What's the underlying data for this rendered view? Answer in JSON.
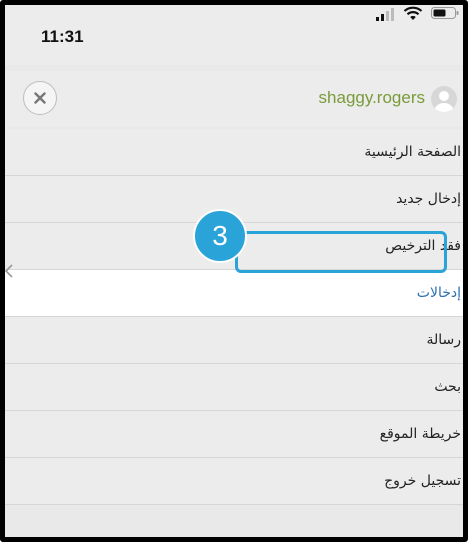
{
  "status_bar": {
    "time": "11:31"
  },
  "header": {
    "username": "shaggy.rogers",
    "close_icon": "close-icon",
    "avatar_icon": "avatar"
  },
  "menu": {
    "items": [
      {
        "label": "الصفحة الرئيسية",
        "active": false
      },
      {
        "label": "إدخال جديد",
        "active": false
      },
      {
        "label": "فقد الترخيص",
        "active": false
      },
      {
        "label": "إدخالات",
        "active": true
      },
      {
        "label": "رسالة",
        "active": false
      },
      {
        "label": "بحث",
        "active": false
      },
      {
        "label": "خريطة الموقع",
        "active": false
      },
      {
        "label": "تسجيل خروج",
        "active": false
      }
    ]
  },
  "callout": {
    "number": "3"
  },
  "colors": {
    "accent": "#2aa4d8",
    "username": "#7a9b3a",
    "active_text": "#2a6fb0"
  }
}
